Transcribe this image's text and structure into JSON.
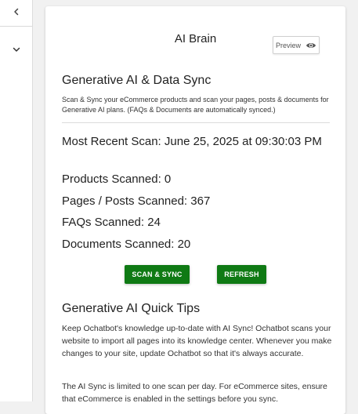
{
  "sidebar": {
    "collapse_icon": "chevron-left-icon",
    "expand_icon": "chevron-down-icon"
  },
  "card": {
    "title": "AI Brain",
    "preview_label": "Preview",
    "preview_icon": "eye-icon"
  },
  "sync": {
    "heading": "Generative AI & Data Sync",
    "description": "Scan & Sync your eCommerce products and scan your pages, posts & documents for Generative AI plans. (FAQs & Documents are automatically synced.)",
    "most_recent_scan": "Most Recent Scan: June 25, 2025 at 09:30:03 PM",
    "products_scanned": "Products Scanned: 0",
    "pages_posts_scanned": "Pages / Posts Scanned: 367",
    "faqs_scanned": "FAQs Scanned: 24",
    "documents_scanned": "Documents Scanned: 20",
    "scan_sync_label": "SCAN & SYNC",
    "refresh_label": "REFRESH"
  },
  "tips": {
    "heading": "Generative AI Quick Tips",
    "paragraph_1": "Keep Ochatbot's knowledge up-to-date with AI Sync! Ochatbot scans your website to import all pages into its knowledge center. Whenever you make changes to your site, update Ochatbot so that it's always accurate.",
    "paragraph_2": "The AI Sync is limited to one scan per day. For eCommerce sites, ensure that eCommerce is enabled in the settings before you sync."
  },
  "colors": {
    "button_green": "#0f7a14",
    "background": "#f1f1f1",
    "card": "#ffffff"
  }
}
